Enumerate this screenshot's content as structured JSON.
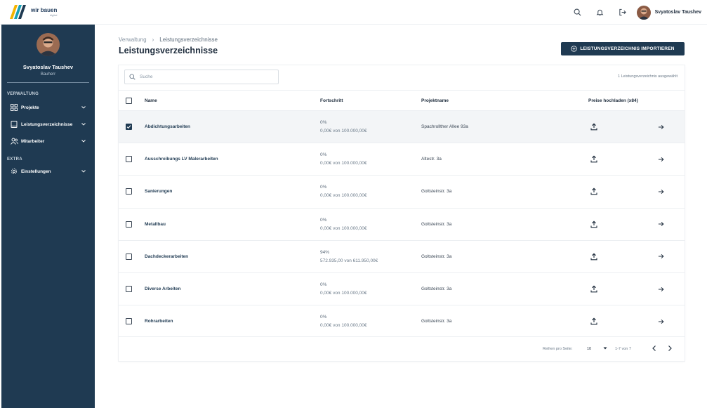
{
  "header": {
    "logo_main": "wir bauen",
    "logo_sub": "digital",
    "user_name": "Svyatoslav Taushev",
    "icons": [
      "search-icon",
      "bell-icon",
      "logout-icon"
    ]
  },
  "sidebar": {
    "profile_name": "Svyatoslav Taushev",
    "profile_role": "Bauherr",
    "sections": {
      "verwaltung": "VERWALTUNG",
      "extra": "EXTRA"
    },
    "items": [
      {
        "label": "Projekte",
        "icon": "grid-icon"
      },
      {
        "label": "Leistungsverzeichnisse",
        "icon": "book-icon"
      },
      {
        "label": "Mitarbeiter",
        "icon": "users-icon"
      },
      {
        "label": "Einstellungen",
        "icon": "gear-icon"
      }
    ]
  },
  "main": {
    "breadcrumb": [
      "Verwaltung",
      "Leistungsverzeichnisse"
    ],
    "title": "Leistungsverzeichnisse",
    "import_button": "LEISTUNGSVERZEICHNIS IMPORTIEREN",
    "search_placeholder": "Suche",
    "selected_info": "1 Leistungsverzeichnis ausgewählt",
    "columns": {
      "name": "Name",
      "progress": "Fortschritt",
      "project": "Projektname",
      "prices": "Preise hochladen (x84)"
    },
    "rows": [
      {
        "name": "Abdichtungsarbeiten",
        "percent": "0%",
        "amount": "0,00€ von 100.000,00€",
        "project": "Spachrollther Allee 93a",
        "checked": true
      },
      {
        "name": "Ausschreibungs LV Malerarbeiten",
        "percent": "0%",
        "amount": "0,00€ von 100.000,00€",
        "project": "Altestr. 3a",
        "checked": false
      },
      {
        "name": "Sanierungen",
        "percent": "0%",
        "amount": "0,00€ von 100.000,00€",
        "project": "Goltsteinstr. 3a",
        "checked": false
      },
      {
        "name": "Metallbau",
        "percent": "0%",
        "amount": "0,00€ von 100.000,00€",
        "project": "Goltsteinstr. 3a",
        "checked": false
      },
      {
        "name": "Dachdeckerarbeiten",
        "percent": "94%",
        "amount": "572.935,00 von 611.950,00€",
        "project": "Goltsteinstr. 3a",
        "checked": false
      },
      {
        "name": "Diverse Arbeiten",
        "percent": "0%",
        "amount": "0,00€ von 100.000,00€",
        "project": "Goltsteinstr. 3a",
        "checked": false
      },
      {
        "name": "Rohrarbeiten",
        "percent": "0%",
        "amount": "0,00€ von 100.000,00€",
        "project": "Goltsteinstr. 3a",
        "checked": false
      }
    ],
    "pagination": {
      "rows_per_page_label": "Reihen pro Seite:",
      "rows_per_page": "10",
      "range": "1-7 von 7"
    }
  },
  "colors": {
    "sidebar": "#1f3a52",
    "accent": "#1f3a52",
    "selected_row": "#f3f5f7"
  }
}
